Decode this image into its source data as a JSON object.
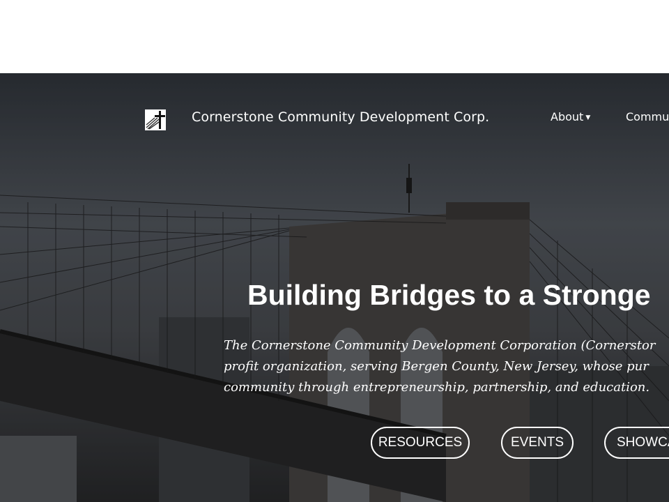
{
  "header": {
    "brand_name": "Cornerstone Community Development Corp.",
    "logo_icon": "cross-logo-icon",
    "nav": [
      {
        "label": "About",
        "has_dropdown": true
      },
      {
        "label": "Commu"
      }
    ]
  },
  "hero": {
    "headline": "Building Bridges to a Stronge",
    "intro_lines": [
      "The Cornerstone Community Development Corporation (Cornerstor",
      "profit organization, serving Bergen County, New Jersey, whose pur",
      "community through entrepreneurship, partnership, and education."
    ],
    "buttons": [
      {
        "label": "RESOURCES"
      },
      {
        "label": "EVENTS"
      },
      {
        "label": "SHOWCA"
      }
    ]
  },
  "colors": {
    "text": "#ffffff",
    "top_background": "#ffffff",
    "hero_overlay": "#2e3136"
  }
}
